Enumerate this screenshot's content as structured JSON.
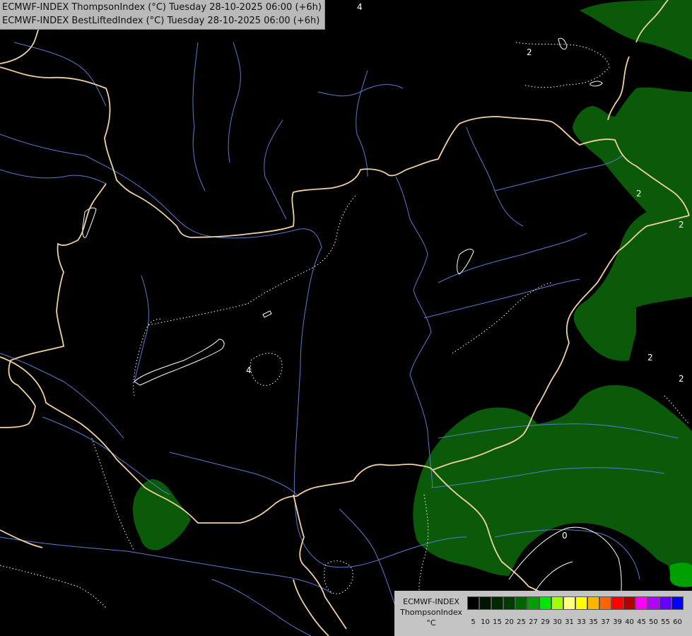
{
  "header": {
    "line1": "ECMWF-INDEX ThompsonIndex (°C) Tuesday 28-10-2025 06:00 (+6h)",
    "line2": "ECMWF-INDEX BestLiftedIndex (°C) Tuesday 28-10-2025 06:00 (+6h)"
  },
  "legend": {
    "title_line1": "ECMWF-INDEX",
    "title_line2": "ThompsonIndex",
    "unit": "°C",
    "ticks": [
      "5",
      "10",
      "15",
      "20",
      "25",
      "27",
      "29",
      "30",
      "31",
      "33",
      "35",
      "37",
      "39",
      "40",
      "45",
      "50",
      "55",
      "60"
    ],
    "colors": [
      "#000000",
      "#001400",
      "#002800",
      "#003c00",
      "#006400",
      "#00a000",
      "#00e600",
      "#a0ff00",
      "#ffff80",
      "#ffff00",
      "#ffb400",
      "#ff6400",
      "#ff0000",
      "#b40000",
      "#ff00ff",
      "#b400ff",
      "#6400ff",
      "#0000ff"
    ]
  },
  "contour_labels": [
    "2",
    "2",
    "2",
    "2",
    "2",
    "4",
    "4",
    "0"
  ],
  "colors": {
    "background": "#000000",
    "index_fill": "#0a5a0a",
    "border_line": "#f0d2a0",
    "river_line": "#5a7acc",
    "contour_line": "#ffffff"
  }
}
